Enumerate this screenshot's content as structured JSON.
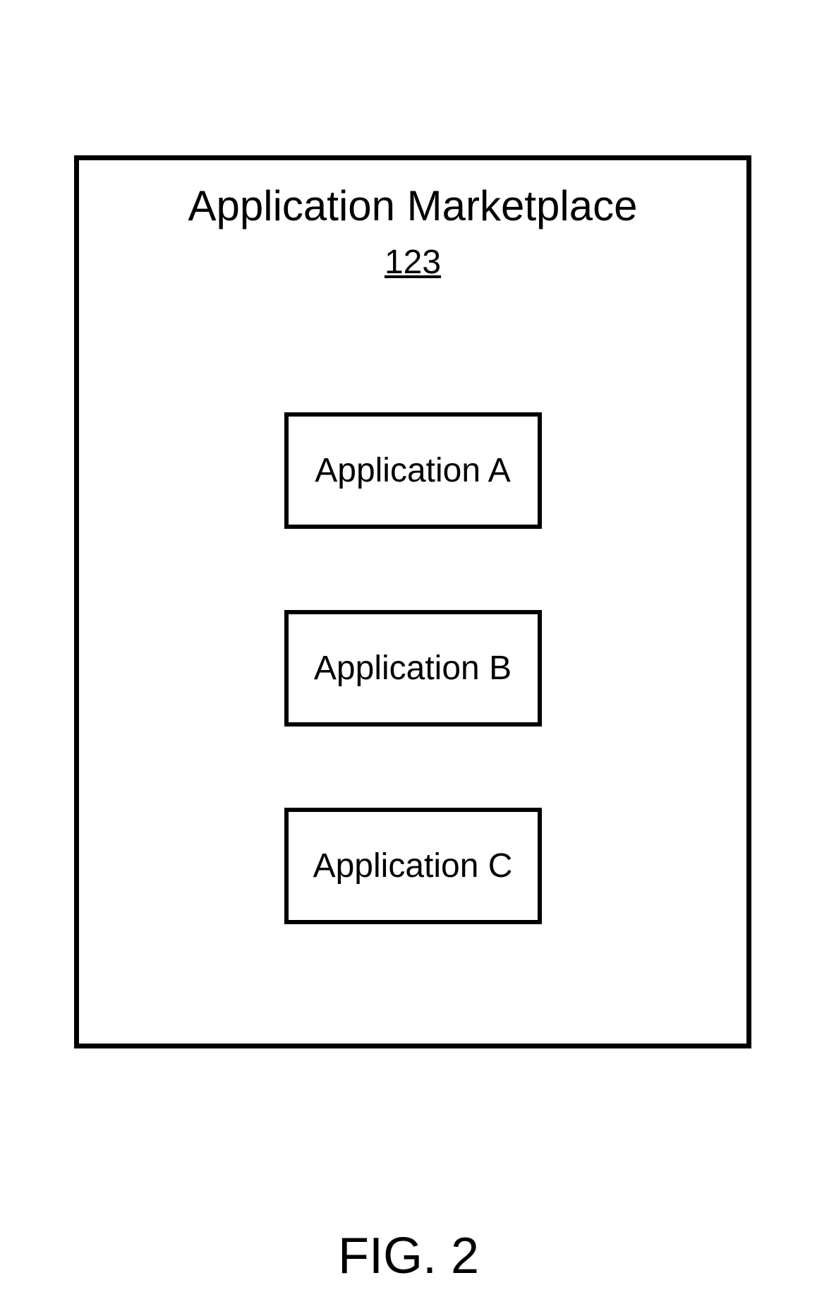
{
  "panel": {
    "title": "Application Marketplace",
    "ref": "123"
  },
  "apps": [
    {
      "label": "Application A"
    },
    {
      "label": "Application B"
    },
    {
      "label": "Application C"
    }
  ],
  "figure_label": "FIG. 2"
}
